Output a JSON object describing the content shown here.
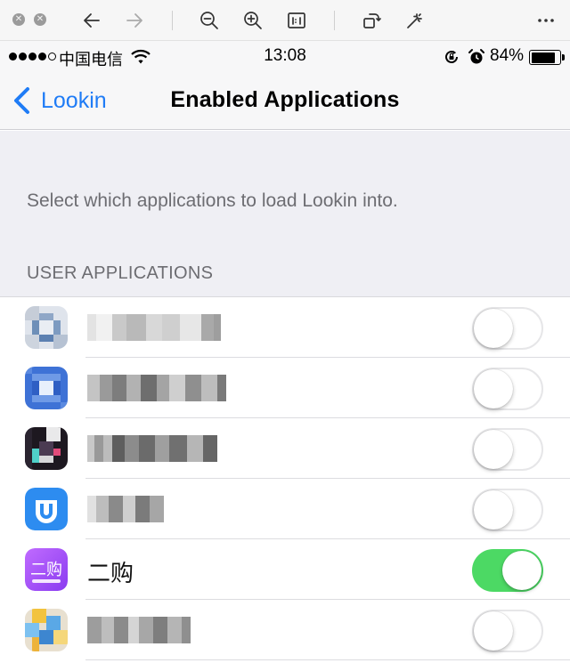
{
  "viewer_toolbar": {
    "icons": [
      "close-dot-icon",
      "minimize-dot-icon",
      "back-arrow-icon",
      "forward-arrow-icon",
      "zoom-out-icon",
      "zoom-in-icon",
      "actual-size-icon",
      "rotate-icon",
      "magic-wand-icon",
      "more-icon"
    ],
    "close_glyph": "✕",
    "min_glyph": "✕"
  },
  "status_bar": {
    "signal_dots": "●●●●○",
    "carrier": "中国电信",
    "time": "13:08",
    "battery_percent": "84%",
    "battery_level": 0.84
  },
  "nav": {
    "back_label": "Lookin",
    "title": "Enabled Applications",
    "accent_color": "#1f7cf6"
  },
  "description": "Select which applications to load Lookin into.",
  "section_header": "USER APPLICATIONS",
  "apps": [
    {
      "name": "",
      "blurred": true,
      "enabled": false
    },
    {
      "name": "",
      "blurred": true,
      "enabled": false
    },
    {
      "name": "",
      "blurred": true,
      "enabled": false
    },
    {
      "name": "",
      "blurred": true,
      "enabled": false
    },
    {
      "name": "二购",
      "blurred": false,
      "enabled": true,
      "icon_text": "二购"
    },
    {
      "name": "",
      "blurred": true,
      "enabled": false
    }
  ],
  "colors": {
    "toggle_on": "#4cd964",
    "group_background": "#efeff4",
    "secondary_text": "#6d6d72"
  }
}
